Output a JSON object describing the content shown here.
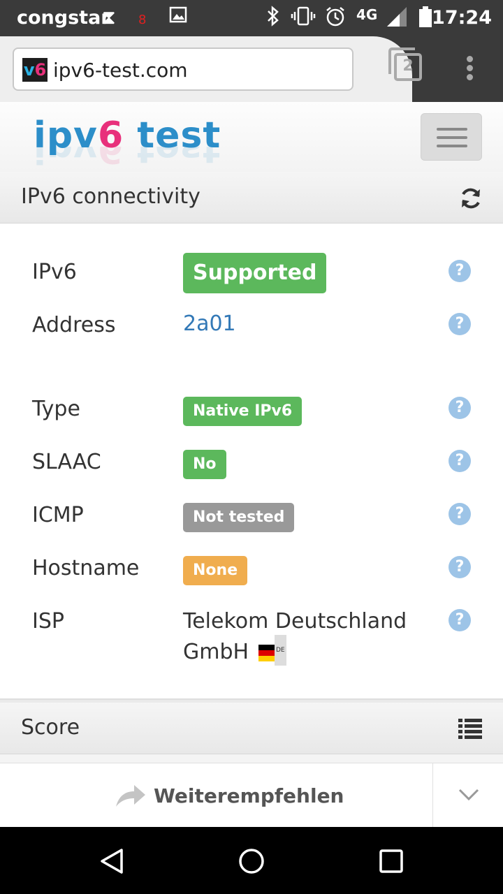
{
  "status_bar": {
    "carrier": "congstar",
    "network": "4G",
    "time": "17:24",
    "notification_count": "8"
  },
  "browser": {
    "url": "ipv6-test.com",
    "favicon_text": "v6",
    "tab_count": "2"
  },
  "site": {
    "logo_prefix": "ipv",
    "logo_six": "6",
    "logo_suffix": " test"
  },
  "connectivity": {
    "title": "IPv6 connectivity",
    "rows": {
      "ipv6": {
        "label": "IPv6",
        "value": "Supported"
      },
      "address": {
        "label": "Address",
        "value": "2a01:"
      },
      "type": {
        "label": "Type",
        "value": "Native IPv6"
      },
      "slaac": {
        "label": "SLAAC",
        "value": "No"
      },
      "icmp": {
        "label": "ICMP",
        "value": "Not tested"
      },
      "hostname": {
        "label": "Hostname",
        "value": "None"
      },
      "isp": {
        "label": "ISP",
        "value": "Telekom Deutschland GmbH",
        "flag_code": "DE"
      }
    }
  },
  "score": {
    "title": "Score"
  },
  "share": {
    "label": "Weiterempfehlen"
  },
  "colors": {
    "success": "#5cb85c",
    "neutral": "#999999",
    "warning": "#f0ad4e",
    "link": "#3379b7",
    "help": "#9dc4e7"
  }
}
